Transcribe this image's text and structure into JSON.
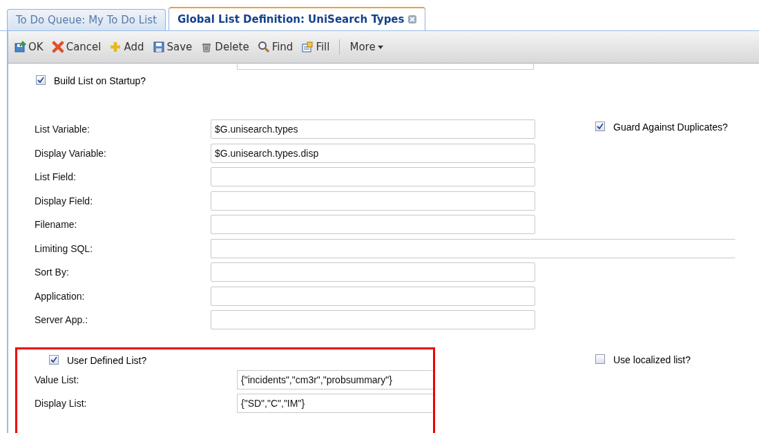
{
  "tabs": [
    {
      "label": "To Do Queue: My To Do List",
      "selected": false,
      "closable": false
    },
    {
      "label": "Global List Definition: UniSearch Types",
      "selected": true,
      "closable": true
    }
  ],
  "toolbar": [
    {
      "label": "OK",
      "kind": "ok"
    },
    {
      "label": "Cancel",
      "kind": "cancel"
    },
    {
      "label": "Add",
      "kind": "add"
    },
    {
      "label": "Save",
      "kind": "save"
    },
    {
      "label": "Delete",
      "kind": "delete"
    },
    {
      "label": "Find",
      "kind": "find"
    },
    {
      "label": "Fill",
      "kind": "fill"
    },
    {
      "label": "More",
      "kind": "more"
    }
  ],
  "build_list": {
    "label": "Build List on Startup?",
    "checked": true
  },
  "guard": {
    "label": "Guard Against Duplicates?",
    "checked": true
  },
  "fields": [
    {
      "label": "List Variable:",
      "value": "$G.unisearch.types",
      "kind": "short"
    },
    {
      "label": "Display Variable:",
      "value": "$G.unisearch.types.disp",
      "kind": "short"
    },
    {
      "label": "List Field:",
      "kind": "short"
    },
    {
      "label": "Display Field:",
      "kind": "short"
    },
    {
      "label": "Filename:",
      "kind": "short"
    },
    {
      "label": "Limiting SQL:",
      "kind": "wide"
    },
    {
      "label": "Sort By:",
      "kind": "short"
    },
    {
      "label": "Application:",
      "kind": "short"
    },
    {
      "label": "Server App.:",
      "kind": "short"
    }
  ],
  "user_defined": {
    "label": "User Defined List?",
    "checked": true
  },
  "localized": {
    "label": "Use localized list?",
    "checked": false
  },
  "list_fields": [
    {
      "label": "Value List:",
      "value": "{\"incidents\",\"cm3r\",\"probsummary\"}",
      "kind": "wide"
    },
    {
      "label": "Display List:",
      "value": "{\"SD\",\"C\",\"IM\"}",
      "kind": "wide"
    }
  ]
}
